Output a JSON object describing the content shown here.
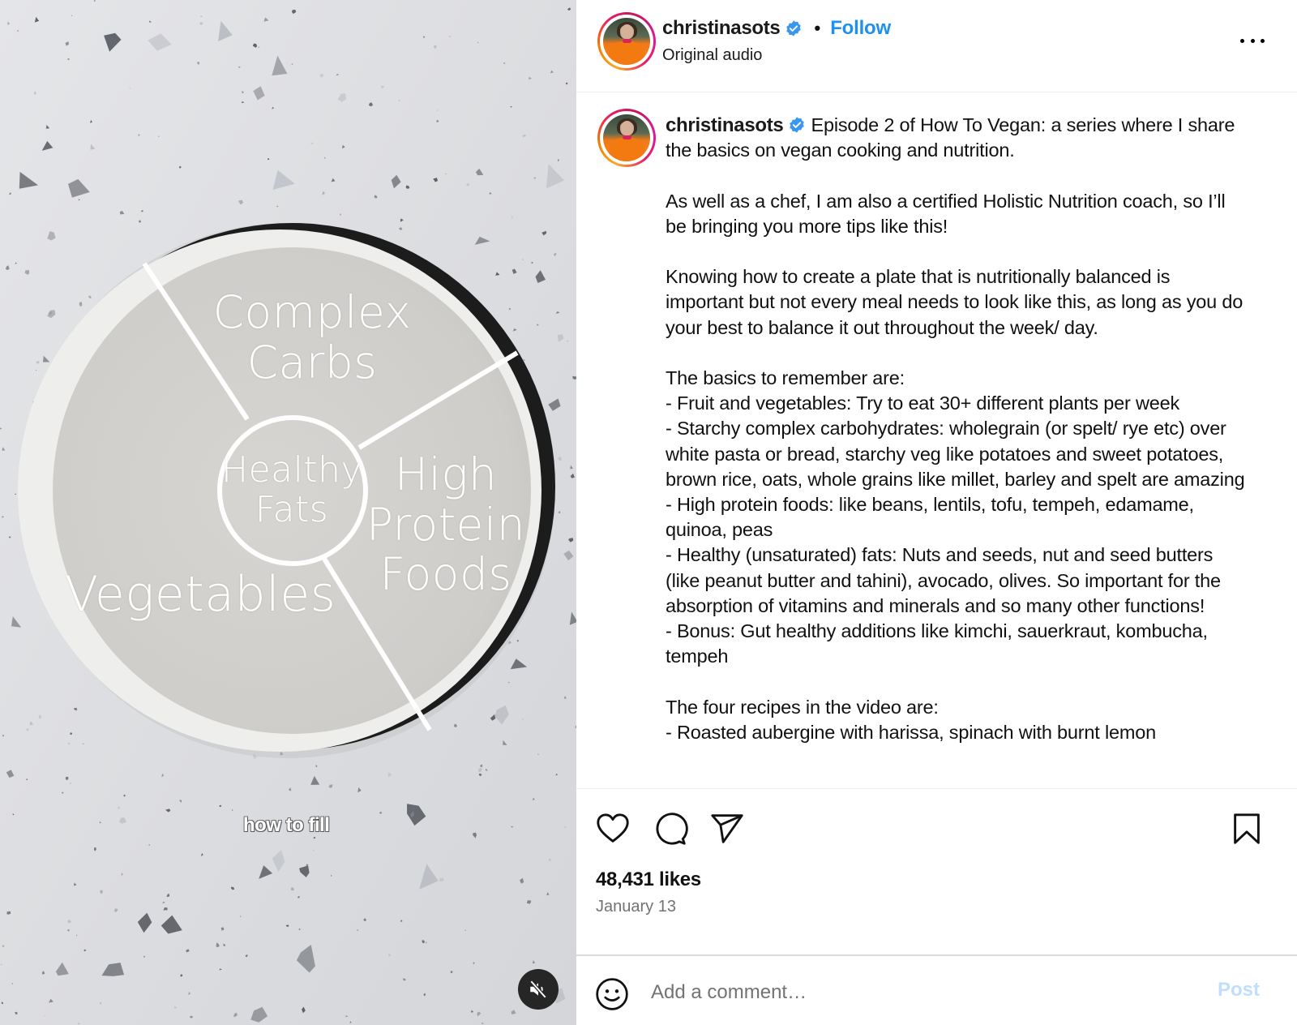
{
  "video": {
    "plate_labels": {
      "carbs": "Complex\nCarbs",
      "fats": "Healthy\nFats",
      "protein": "High\nProtein\nFoods",
      "vegetables": "Vegetables"
    },
    "overlay_caption": "how to fill",
    "mute_icon": "speaker-muted-icon"
  },
  "header": {
    "username": "christinasots",
    "verified": true,
    "separator": "•",
    "follow_label": "Follow",
    "subtitle": "Original audio",
    "more_icon": "more-horizontal-icon"
  },
  "caption": {
    "username": "christinasots",
    "paragraphs": [
      "Episode 2 of How To Vegan: a series where I share the basics on vegan cooking and nutrition.",
      "As well as a chef, I am also a certified Holistic Nutrition coach, so I’ll be bringing you more tips like this!",
      "Knowing how to create a plate that is nutritionally balanced is important but not every meal needs to look like this, as long as you do your best to balance it out throughout the week/ day.",
      "The basics to remember are:",
      "- Fruit and vegetables: Try to eat 30+ different plants per week",
      "- Starchy complex carbohydrates: wholegrain (or spelt/ rye etc) over white pasta or bread, starchy veg like potatoes and sweet potatoes, brown rice, oats, whole grains like millet, barley and spelt are amazing",
      "- High protein foods: like beans, lentils, tofu, tempeh, edamame, quinoa, peas",
      "- Healthy (unsaturated) fats: Nuts and seeds, nut and seed butters (like peanut butter and tahini), avocado, olives. So important for the absorption of vitamins and minerals and so many other functions!",
      "- Bonus: Gut healthy additions like kimchi, sauerkraut, kombucha, tempeh",
      "The four recipes in the video are:",
      "- Roasted aubergine with harissa, spinach with burnt lemon"
    ]
  },
  "actions": {
    "like_icon": "heart-icon",
    "comment_icon": "comment-bubble-icon",
    "share_icon": "paper-plane-icon",
    "save_icon": "bookmark-icon",
    "likes": "48,431 likes",
    "date": "January 13"
  },
  "comment": {
    "emoji_icon": "smiley-icon",
    "placeholder": "Add a comment…",
    "value": "",
    "post_label": "Post"
  },
  "colors": {
    "follow": "#1e90f0",
    "verified": "#3897f0",
    "post_disabled": "#c0dffd",
    "muted_text": "#737373"
  }
}
